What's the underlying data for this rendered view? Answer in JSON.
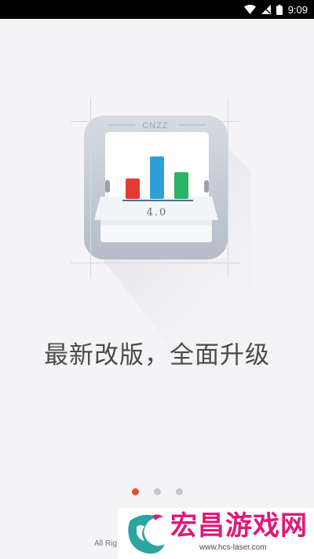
{
  "status_bar": {
    "time": "9:09",
    "icons": [
      "wifi-icon",
      "signal-icon",
      "battery-icon"
    ]
  },
  "logo": {
    "brand": "CNZZ",
    "version": "4.0",
    "bars": [
      {
        "color": "#e23b33"
      },
      {
        "color": "#2f9fd9"
      },
      {
        "color": "#28b563"
      }
    ]
  },
  "headline": "最新改版，全面升级",
  "pager": {
    "total": 3,
    "active": 1
  },
  "footer": {
    "copyright": "All Rig"
  },
  "watermark": {
    "title": "宏昌游戏网",
    "url": "www.hcs-laser.com"
  },
  "colors": {
    "accent": "#e2522f",
    "watermark": "#e0187a",
    "headline": "#4a4a4a"
  }
}
